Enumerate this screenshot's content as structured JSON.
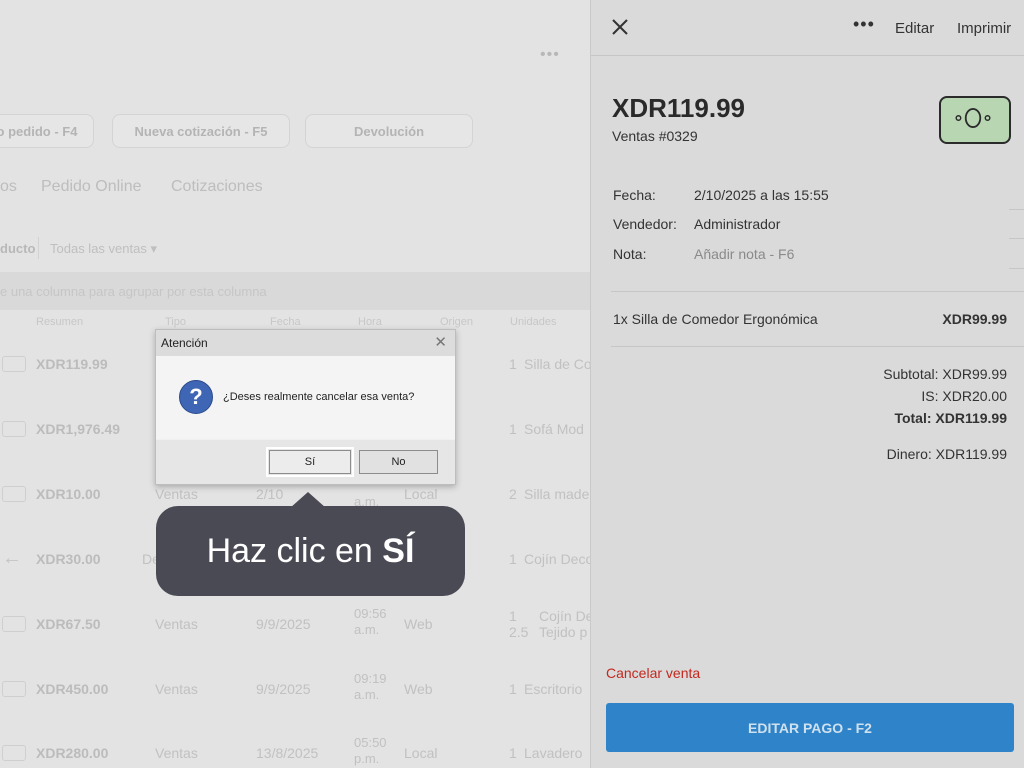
{
  "background": {
    "more_dots": "•••",
    "action_buttons": [
      "o pedido - F4",
      "Nueva cotización - F5",
      "Devolución"
    ],
    "tabs": [
      "os",
      "Pedido Online",
      "Cotizaciones"
    ],
    "filter_label": "ducto",
    "filter_select": "Todas las ventas ▾",
    "group_hint": "e una columna para agrupar por esta columna",
    "columns": [
      "Resumen",
      "Tipo",
      "Fecha",
      "Hora",
      "Origen",
      "Unidades"
    ],
    "rows": [
      {
        "amount": "XDR119.99",
        "type": "",
        "date": "",
        "time": "",
        "channel": "",
        "qty": "1",
        "product": "Silla de Co"
      },
      {
        "amount": "XDR1,976.49",
        "type": "",
        "date": "",
        "time": "",
        "channel": "",
        "qty": "1",
        "product": "Sofá Mod"
      },
      {
        "amount": "XDR10.00",
        "type": "Ventas",
        "date": "2/10",
        "time": "a.m.",
        "channel": "Local",
        "qty": "2",
        "product": "Silla made"
      },
      {
        "amount": "XDR30.00",
        "type": "De",
        "date": "",
        "time": "",
        "channel": "",
        "qty": "1",
        "product": "Cojín Deco"
      },
      {
        "amount": "XDR67.50",
        "type": "Ventas",
        "date": "9/9/2025",
        "time": "09:56 a.m.",
        "channel": "Web",
        "qty": "1 2.5",
        "product": "Cojín De Tejido p"
      },
      {
        "amount": "XDR450.00",
        "type": "Ventas",
        "date": "9/9/2025",
        "time": "09:19 a.m.",
        "channel": "Web",
        "qty": "1",
        "product": "Escritorio"
      },
      {
        "amount": "XDR280.00",
        "type": "Ventas",
        "date": "13/8/2025",
        "time": "05:50 p.m.",
        "channel": "Local",
        "qty": "1",
        "product": "Lavadero"
      }
    ]
  },
  "panel": {
    "edit_label": "Editar",
    "print_label": "Imprimir",
    "more_label": "•••",
    "total_big": "XDR119.99",
    "sale_id": "Ventas #0329",
    "fields": [
      {
        "label": "Fecha:",
        "value": "2/10/2025 a las 15:55"
      },
      {
        "label": "Vendedor:",
        "value": "Administrador"
      },
      {
        "label": "Nota:",
        "value": "Añadir nota - F6"
      }
    ],
    "item_desc": "1x Silla de Comedor Ergonómica",
    "item_amount": "XDR99.99",
    "subtotal": "Subtotal: XDR99.99",
    "tax": "IS: XDR20.00",
    "total": "Total: XDR119.99",
    "cash": "Dinero: XDR119.99",
    "cancel_label": "Cancelar venta",
    "pay_button": "EDITAR PAGO - F2"
  },
  "dialog": {
    "title": "Atención",
    "message": "¿Deses realmente cancelar esa venta?",
    "yes_label": "Sí",
    "no_label": "No"
  },
  "tooltip": {
    "text_prefix": "Haz clic en ",
    "text_bold": "SÍ"
  }
}
